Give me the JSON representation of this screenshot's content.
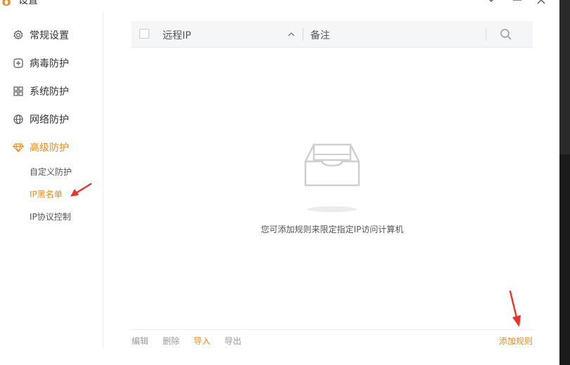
{
  "window": {
    "title": "设置"
  },
  "sidebar": {
    "items": [
      {
        "label": "常规设置",
        "icon": "gear-icon"
      },
      {
        "label": "病毒防护",
        "icon": "plus-square-icon"
      },
      {
        "label": "系统防护",
        "icon": "grid-icon"
      },
      {
        "label": "网络防护",
        "icon": "globe-icon"
      },
      {
        "label": "高级防护",
        "icon": "diamond-icon"
      }
    ],
    "sub_items": [
      {
        "label": "自定义防护"
      },
      {
        "label": "IP黑名单"
      },
      {
        "label": "IP协议控制"
      }
    ]
  },
  "table": {
    "columns": [
      "远程IP",
      "备注"
    ],
    "empty_message": "您可添加规则来限定指定IP访问计算机"
  },
  "footer": {
    "edit": "编辑",
    "delete": "删除",
    "import": "导入",
    "export": "导出",
    "add_rule": "添加规则"
  },
  "colors": {
    "accent": "#f08a1f",
    "annotation": "#e8342a"
  }
}
